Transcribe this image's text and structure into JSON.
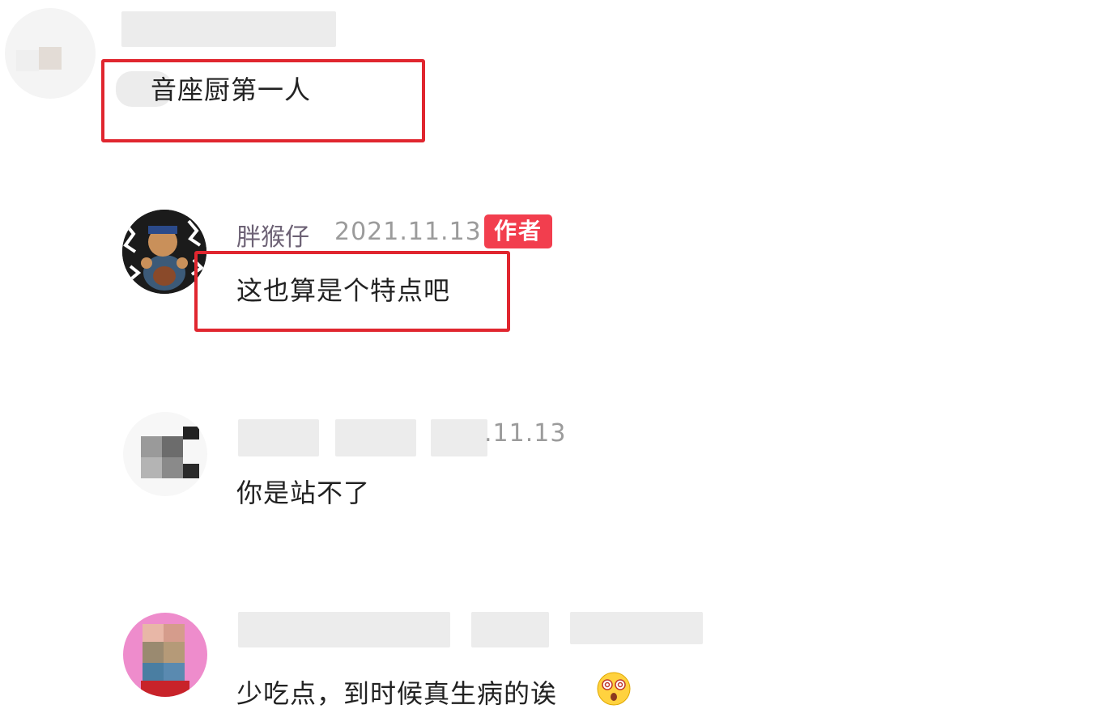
{
  "comments": [
    {
      "username": "",
      "date": "",
      "text": "音座厨第一人",
      "highlighted": true
    },
    {
      "username": "胖猴仔",
      "date": "2021.11.13",
      "badge": "作者",
      "text": "这也算是个特点吧",
      "highlighted": true
    },
    {
      "username": "",
      "date": ".11.13",
      "text": "你是站不了"
    },
    {
      "username": "",
      "date": "",
      "text": "少吃点，到时候真生病的诶",
      "emoji": "dizzy-face-emoji"
    }
  ],
  "colors": {
    "highlight_border": "#e0262f",
    "badge_background": "#f23e4e",
    "username": "#6d6275",
    "date": "#9b9b9b"
  }
}
